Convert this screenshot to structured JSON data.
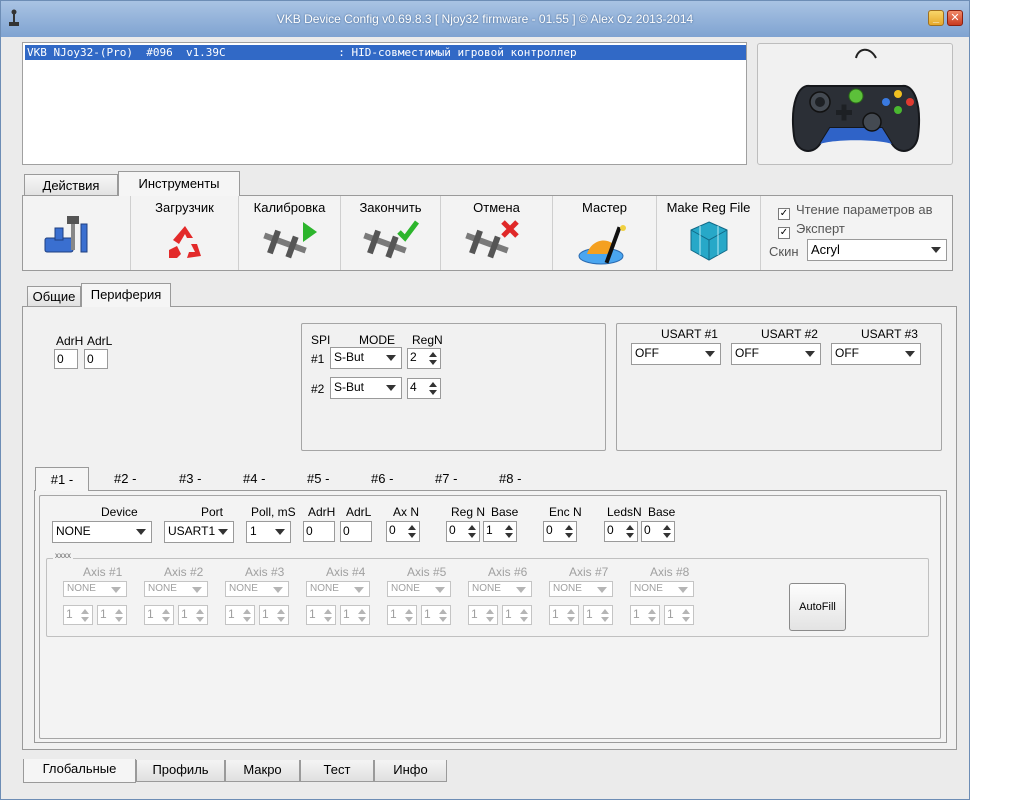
{
  "window": {
    "title": "VKB Device Config v0.69.8.3 [ Njoy32 firmware - 01.55 ] © Alex Oz 2013-2014"
  },
  "device_list": {
    "selected_row": "VKB NJoy32-(Pro)  #096  v1.39C                 : HID-совместимый игровой контроллер"
  },
  "top_tabs": [
    "Действия",
    "Инструменты"
  ],
  "toolbar": {
    "loader": "Загрузчик",
    "calibration": "Калибровка",
    "finish": "Закончить",
    "cancel": "Отмена",
    "wizard": "Мастер",
    "make_reg_file": "Make Reg File",
    "read_params": "Чтение параметров ав",
    "expert": "Эксперт",
    "skin_label": "Скин",
    "skin_value": "Acryl"
  },
  "sub_tabs": [
    "Общие",
    "Периферия"
  ],
  "adr": {
    "adrh_label": "AdrH",
    "adrl_label": "AdrL",
    "adrh_value": "0",
    "adrl_value": "0"
  },
  "spi": {
    "label": "SPI",
    "mode_label": "MODE",
    "regn_label": "RegN",
    "rows": [
      {
        "num": "#1",
        "mode": "S-But",
        "regn": "2"
      },
      {
        "num": "#2",
        "mode": "S-But",
        "regn": "4"
      }
    ]
  },
  "usart": [
    {
      "label": "USART #1",
      "value": "OFF"
    },
    {
      "label": "USART #2",
      "value": "OFF"
    },
    {
      "label": "USART #3",
      "value": "OFF"
    }
  ],
  "device_tabs": [
    "#1 -",
    "#2 -",
    "#3 -",
    "#4 -",
    "#5 -",
    "#6 -",
    "#7 -",
    "#8 -"
  ],
  "device_cfg": {
    "device_label": "Device",
    "device_value": "NONE",
    "port_label": "Port",
    "port_value": "USART1",
    "poll_label": "Poll, mS",
    "poll_value": "1",
    "adrh_label": "AdrH",
    "adrh_value": "0",
    "adrl_label": "AdrL",
    "adrl_value": "0",
    "axn_label": "Ax N",
    "axn_value": "0",
    "regn_label": "Reg N",
    "regn_value": "0",
    "base_label": "Base",
    "base_value": "1",
    "encn_label": "Enc N",
    "encn_value": "0",
    "ledsn_label": "LedsN",
    "ledsn_value": "0",
    "base2_label": "Base",
    "base2_value": "0"
  },
  "axes_group": {
    "caption": "xxxx",
    "axes": [
      {
        "label": "Axis #1",
        "value": "NONE",
        "a": "1",
        "b": "1"
      },
      {
        "label": "Axis #2",
        "value": "NONE",
        "a": "1",
        "b": "1"
      },
      {
        "label": "Axis #3",
        "value": "NONE",
        "a": "1",
        "b": "1"
      },
      {
        "label": "Axis #4",
        "value": "NONE",
        "a": "1",
        "b": "1"
      },
      {
        "label": "Axis #5",
        "value": "NONE",
        "a": "1",
        "b": "1"
      },
      {
        "label": "Axis #6",
        "value": "NONE",
        "a": "1",
        "b": "1"
      },
      {
        "label": "Axis #7",
        "value": "NONE",
        "a": "1",
        "b": "1"
      },
      {
        "label": "Axis #8",
        "value": "NONE",
        "a": "1",
        "b": "1"
      }
    ],
    "autofill": "AutoFill"
  },
  "bottom_tabs": [
    "Глобальные",
    "Профиль",
    "Макро",
    "Тест",
    "Инфо"
  ]
}
